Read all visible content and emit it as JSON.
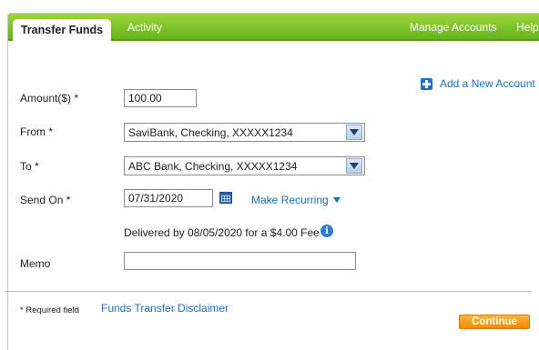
{
  "tabs": {
    "transfer_funds": "Transfer Funds",
    "activity": "Activity",
    "manage_accounts": "Manage Accounts",
    "help": "Help"
  },
  "add_account": {
    "label": "Add a New Account",
    "icon": "plus-icon"
  },
  "form": {
    "amount": {
      "label": "Amount($) *",
      "value": "100.00"
    },
    "from": {
      "label": "From *",
      "value": "SaviBank, Checking, XXXXX1234"
    },
    "to": {
      "label": "To *",
      "value": "ABC Bank, Checking, XXXXX1234"
    },
    "send_on": {
      "label": "Send On *",
      "value": "07/31/2020"
    },
    "make_recurring": "Make Recurring",
    "delivery_note": "Delivered by 08/05/2020 for a $4.00 Fee",
    "memo": {
      "label": "Memo",
      "value": ""
    }
  },
  "footer": {
    "required_note": "* Required field",
    "disclaimer_link": "Funds Transfer Disclaimer",
    "continue_label": "Continue"
  },
  "colors": {
    "tab_green": "#67b31d",
    "link_blue": "#1f6ec2",
    "continue_orange": "#f08a00"
  }
}
